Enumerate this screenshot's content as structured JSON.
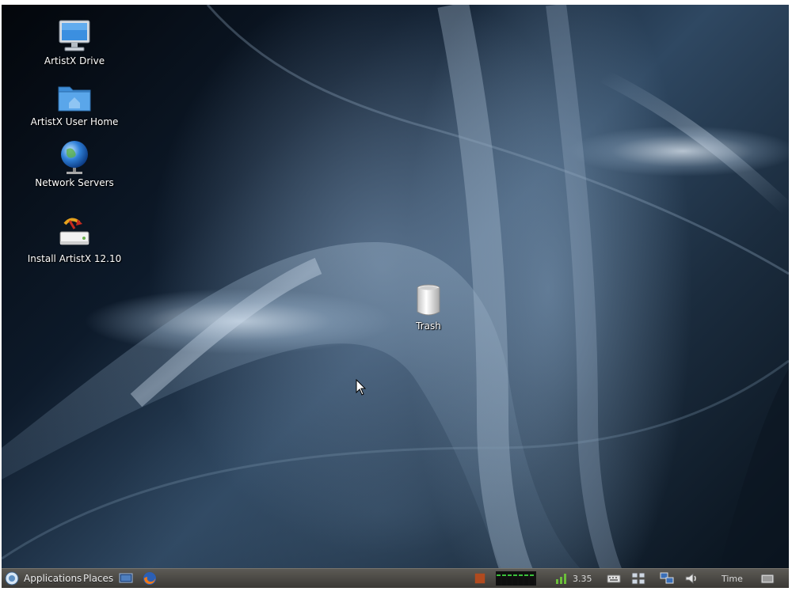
{
  "desktop": {
    "icons": [
      {
        "label": "ArtistX Drive",
        "icon": "computer-drive-icon"
      },
      {
        "label": "ArtistX User Home",
        "icon": "home-folder-icon"
      },
      {
        "label": "Network Servers",
        "icon": "network-globe-icon"
      },
      {
        "label": "Install ArtistX 12.10",
        "icon": "installer-icon"
      },
      {
        "label": "Trash",
        "icon": "trash-icon"
      }
    ]
  },
  "panel": {
    "applications_label": "Applications",
    "places_label": "Places",
    "tray_value": "3.35",
    "time_label": "Time"
  },
  "colors": {
    "panel": "#4a4843",
    "wallpaper_dark": "#0a1421",
    "wallpaper_light": "#7c97b2"
  }
}
